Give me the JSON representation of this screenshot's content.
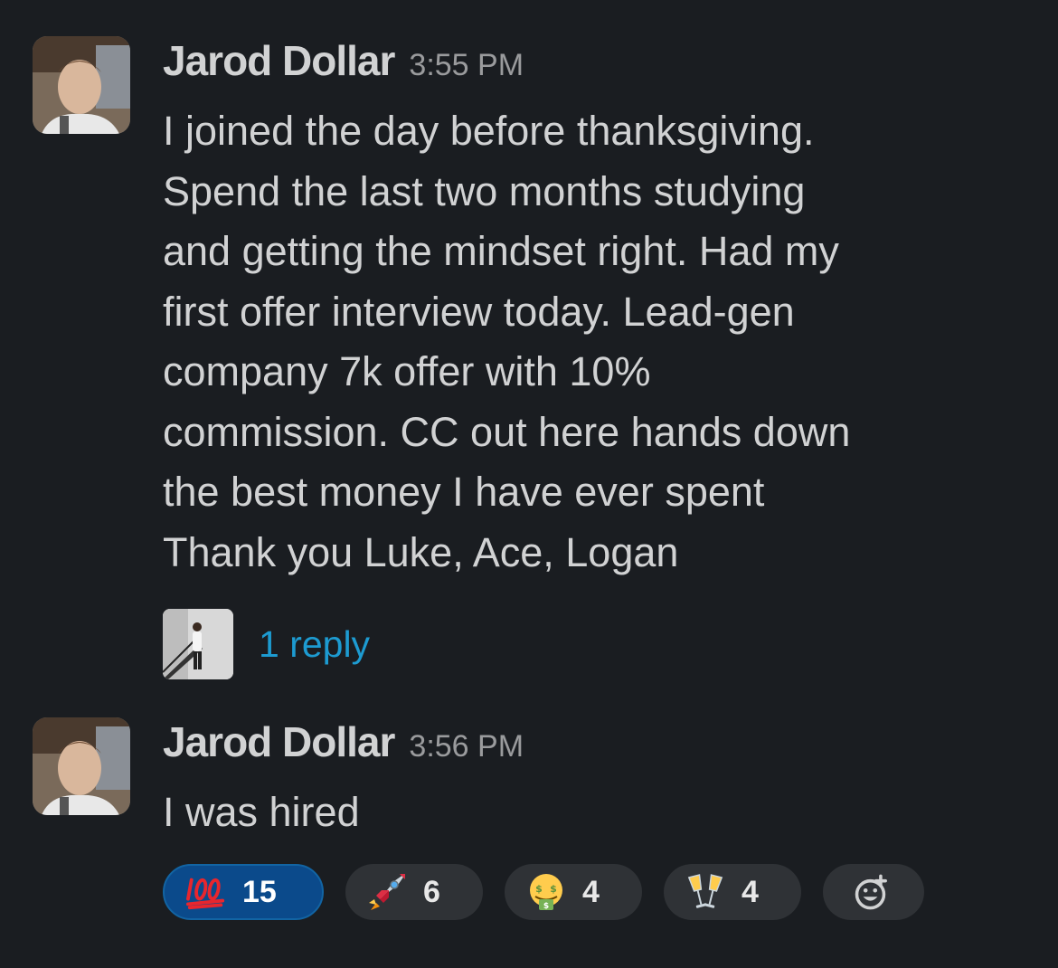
{
  "messages": [
    {
      "author": "Jarod Dollar",
      "time": "3:55 PM",
      "lines": [
        "I joined the day before thanksgiving.",
        "Spend the last two months studying",
        "and getting the mindset right. Had my",
        "first offer interview today. Lead-gen",
        "company 7k offer with 10%",
        "commission. CC out here hands down",
        "the best money I have ever spent",
        "Thank you Luke, Ace, Logan"
      ],
      "thread": {
        "reply_label": "1 reply"
      }
    },
    {
      "author": "Jarod Dollar",
      "time": "3:56 PM",
      "lines": [
        "I was hired"
      ]
    }
  ],
  "reactions": [
    {
      "icon": "hundred-points-icon",
      "count": "15",
      "active": true
    },
    {
      "icon": "rocket-icon",
      "count": "6",
      "active": false
    },
    {
      "icon": "money-mouth-face-icon",
      "count": "4",
      "active": false
    },
    {
      "icon": "clinking-glasses-icon",
      "count": "4",
      "active": false
    }
  ],
  "add_reaction_icon": "add-reaction-icon",
  "colors": {
    "background": "#1a1d21",
    "text": "#d1d2d3",
    "link": "#1d9bd1",
    "active_reaction": "#0b4a8b",
    "reaction_pill": "#2f3236"
  }
}
